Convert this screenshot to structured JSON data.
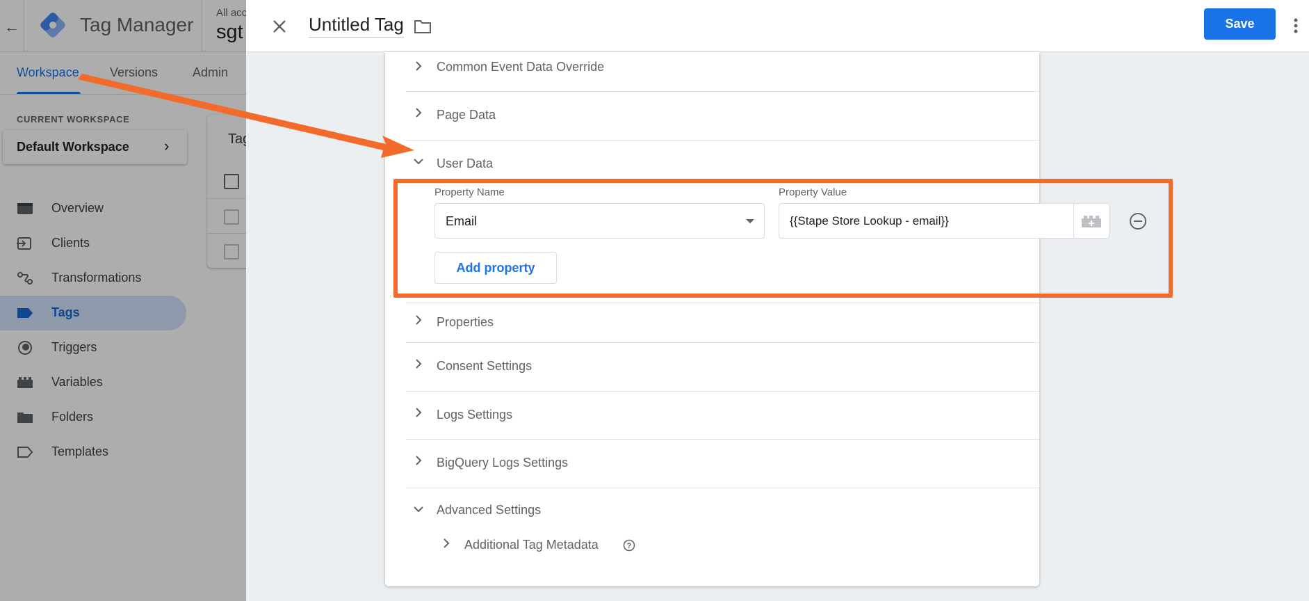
{
  "background": {
    "app_title": "Tag Manager",
    "account_line": "All acc",
    "container_name": "sgt",
    "tabs": [
      "Workspace",
      "Versions",
      "Admin"
    ],
    "current_workspace_label": "CURRENT WORKSPACE",
    "workspace_name": "Default Workspace",
    "nav": [
      {
        "label": "Overview",
        "icon": "overview-icon"
      },
      {
        "label": "Clients",
        "icon": "clients-icon"
      },
      {
        "label": "Transformations",
        "icon": "transformations-icon"
      },
      {
        "label": "Tags",
        "icon": "tag-icon",
        "active": true
      },
      {
        "label": "Triggers",
        "icon": "triggers-icon"
      },
      {
        "label": "Variables",
        "icon": "variables-icon"
      },
      {
        "label": "Folders",
        "icon": "folder-icon"
      },
      {
        "label": "Templates",
        "icon": "templates-icon"
      }
    ],
    "tags_card_title": "Tag"
  },
  "panel": {
    "title": "Untitled Tag",
    "save_label": "Save",
    "sections_top": [
      "Common Event Data Override",
      "Page Data"
    ],
    "user_data": {
      "label": "User Data",
      "property_name_label": "Property Name",
      "property_value_label": "Property Value",
      "property_name": "Email",
      "property_value": "{{Stape Store Lookup - email}}",
      "add_property_label": "Add property"
    },
    "sections_bottom": [
      "Properties",
      "Consent Settings",
      "Logs Settings",
      "BigQuery Logs Settings"
    ],
    "advanced": {
      "label": "Advanced Settings",
      "sub_label": "Additional Tag Metadata"
    }
  },
  "colors": {
    "accent": "#1a73e8",
    "annotation": "#f26b2a"
  }
}
